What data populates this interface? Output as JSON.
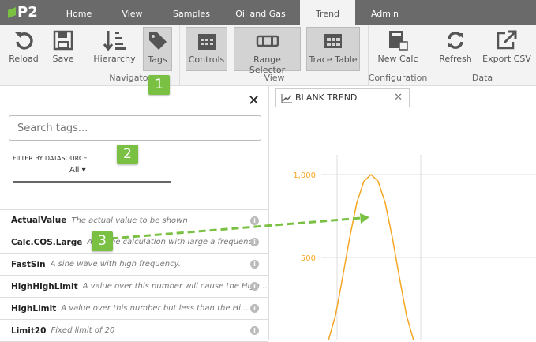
{
  "app": {
    "logo": "P2"
  },
  "nav": {
    "tabs": [
      "Home",
      "View",
      "Samples",
      "Oil and Gas",
      "Trend",
      "Admin"
    ],
    "active": "Trend"
  },
  "ribbon": {
    "reload": "Reload",
    "save": "Save",
    "hierarchy": "Hierarchy",
    "tags": "Tags",
    "navigators": "Navigators",
    "controls": "Controls",
    "range_selector": "Range Selector",
    "trace_table": "Trace Table",
    "view": "View",
    "new_calc": "New Calc",
    "configuration": "Configuration",
    "refresh": "Refresh",
    "export_csv": "Export CSV",
    "data": "Data"
  },
  "panel": {
    "search_placeholder": "Search tags...",
    "filter_label": "FILTER BY DATASOURCE",
    "filter_value": "All",
    "tags": [
      {
        "name": "ActualValue",
        "desc": "The actual value to be shown"
      },
      {
        "name": "Calc.COS.Large",
        "desc": "A cosine calculation with large a frequency."
      },
      {
        "name": "FastSin",
        "desc": "A sine wave with high frequency."
      },
      {
        "name": "HighHighLimit",
        "desc": "A value over this number will cause the HighHigh alarm"
      },
      {
        "name": "HighLimit",
        "desc": "A value over this number but less than the HighHigh limit"
      },
      {
        "name": "Limit20",
        "desc": "Fixed limit of 20"
      }
    ]
  },
  "trend": {
    "tab_label": "BLANK TREND"
  },
  "annotations": [
    "1",
    "2",
    "3"
  ],
  "colors": {
    "accent": "#7ac143",
    "series": "#f5a623"
  },
  "chart_data": {
    "type": "line",
    "yticks": [
      "1,000",
      "500"
    ],
    "ytick_values": [
      1000,
      500
    ],
    "ylim": [
      0,
      1000
    ],
    "series": [
      {
        "name": "Calc.COS.Large",
        "x": [
          0,
          1,
          2,
          3,
          4,
          5,
          6,
          7,
          8,
          9,
          10,
          11,
          12
        ],
        "y": [
          0,
          150,
          380,
          620,
          830,
          960,
          1000,
          960,
          830,
          620,
          380,
          150,
          0
        ]
      }
    ]
  }
}
